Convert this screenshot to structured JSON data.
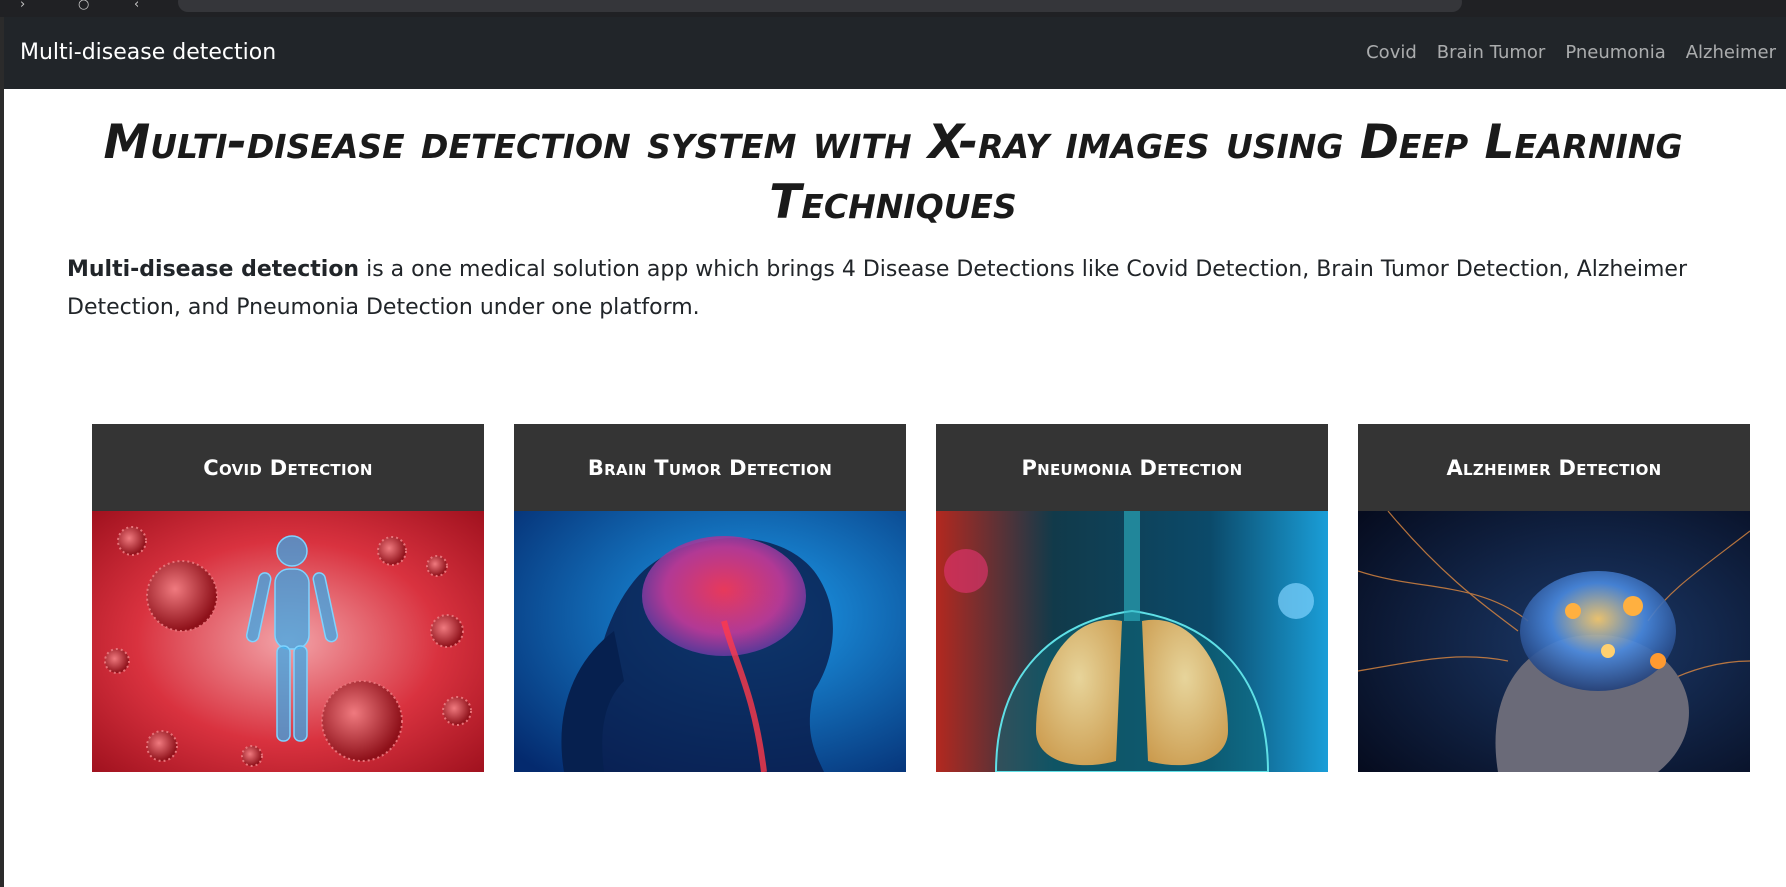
{
  "navbar": {
    "brand": "Multi-disease detection",
    "links": [
      "Covid",
      "Brain Tumor",
      "Pneumonia",
      "Alzheimer"
    ]
  },
  "hero": {
    "title": "Multi-disease detection system with X-ray images using Deep Learning Techniques",
    "intro_bold": "Multi-disease detection",
    "intro_rest": " is a one medical solution app which brings 4 Disease Detections like Covid Detection, Brain Tumor Detection, Alzheimer Detection, and Pneumonia Detection under one platform."
  },
  "cards": [
    {
      "title": "Covid Detection",
      "image": "covid-virus-human-figure-illustration"
    },
    {
      "title": "Brain Tumor Detection",
      "image": "glowing-brain-headache-illustration"
    },
    {
      "title": "Pneumonia Detection",
      "image": "lungs-xray-illustration"
    },
    {
      "title": "Alzheimer Detection",
      "image": "elderly-man-neural-brain-illustration"
    }
  ],
  "colors": {
    "navbar_bg": "#212529",
    "card_header_bg": "#343434",
    "nav_link": "rgba(255,255,255,0.62)"
  }
}
